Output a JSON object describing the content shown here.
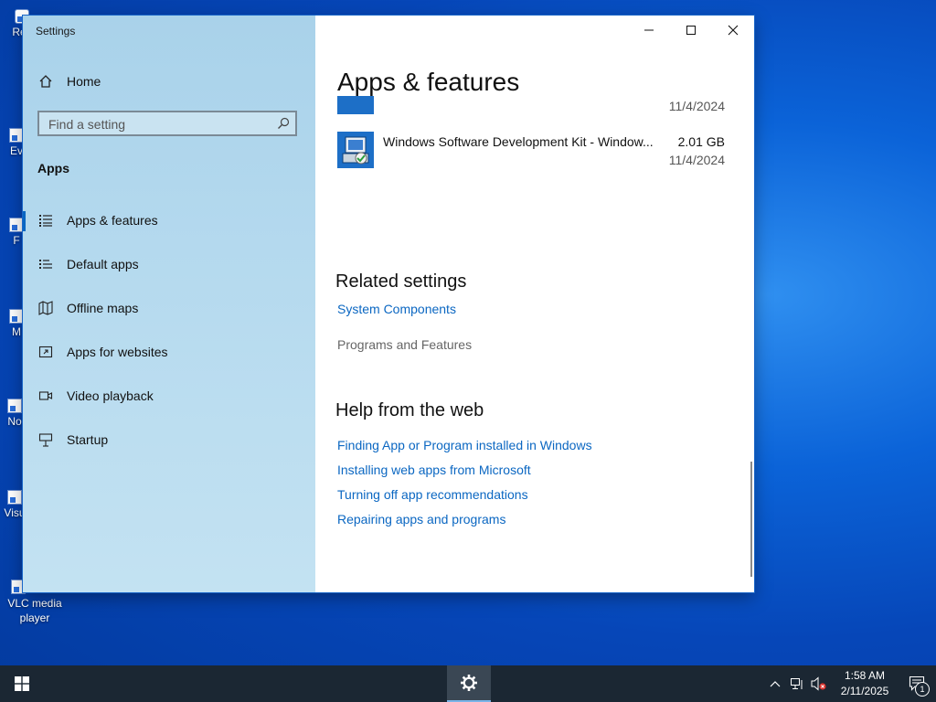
{
  "desktop": {
    "icons": [
      {
        "label": "Rec",
        "icon": "recycle-bin-icon"
      },
      {
        "label": "Ev",
        "icon": "shortcut-icon"
      },
      {
        "label": "F",
        "icon": "shortcut-icon"
      },
      {
        "label": "M",
        "icon": "shortcut-icon"
      },
      {
        "label": "No",
        "icon": "shortcut-icon"
      },
      {
        "label": "Visu",
        "icon": "shortcut-icon"
      },
      {
        "label": "VLC media player",
        "icon": "vlc-icon"
      }
    ]
  },
  "window": {
    "title": "Settings",
    "controls": {
      "minimize": "minimize-icon",
      "maximize": "maximize-icon",
      "close": "close-icon"
    }
  },
  "sidebar": {
    "home_label": "Home",
    "search_placeholder": "Find a setting",
    "section_label": "Apps",
    "items": [
      {
        "label": "Apps & features",
        "icon": "apps-features-icon",
        "selected": true
      },
      {
        "label": "Default apps",
        "icon": "default-apps-icon"
      },
      {
        "label": "Offline maps",
        "icon": "offline-maps-icon"
      },
      {
        "label": "Apps for websites",
        "icon": "apps-for-websites-icon"
      },
      {
        "label": "Video playback",
        "icon": "video-playback-icon"
      },
      {
        "label": "Startup",
        "icon": "startup-icon"
      }
    ]
  },
  "main": {
    "title": "Apps & features",
    "apps": [
      {
        "name": "",
        "size": "",
        "date": "11/4/2024"
      },
      {
        "name": "Windows Software Development Kit - Window...",
        "size": "2.01 GB",
        "date": "11/4/2024"
      }
    ],
    "related_settings": {
      "heading": "Related settings",
      "link": "System Components",
      "text": "Programs and Features"
    },
    "help": {
      "heading": "Help from the web",
      "links": [
        "Finding App or Program installed in Windows",
        "Installing web apps from Microsoft",
        "Turning off app recommendations",
        "Repairing apps and programs"
      ]
    }
  },
  "taskbar": {
    "clock_time": "1:58 AM",
    "clock_date": "2/11/2025",
    "notification_count": "1"
  },
  "colors": {
    "accent": "#0b67c2",
    "sidebar_bg": "#b4d9ee",
    "taskbar_bg": "#1b2733"
  }
}
